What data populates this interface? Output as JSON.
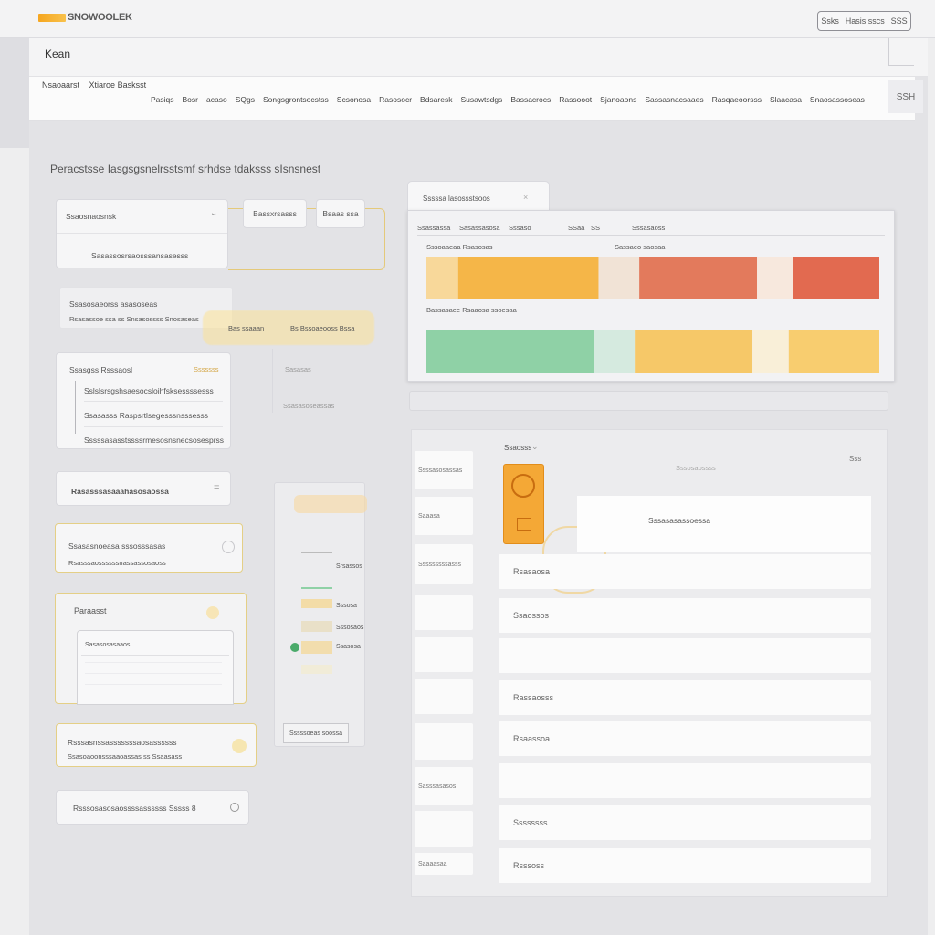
{
  "topbar": {
    "logo_text": "SNOWOOLEK",
    "button_left": "Ssks",
    "button_mid": "Hasis sscs",
    "button_right": "SSS"
  },
  "header": {
    "title": "Kean"
  },
  "breadcrumb": {
    "item1": "Nsaoaarst",
    "item2": "Xtiaroe Basksst"
  },
  "nav_tabs": [
    "Pasiqs",
    "Bosr",
    "acaso",
    "SQgs",
    "Songsgrontsocstss",
    "Scsonosa",
    "Rasosocr",
    "Bdsaresk",
    "Susawtsdgs",
    "Bassacrocs",
    "Rassooot",
    "Sjanoaons",
    "Sassasnacsaaes",
    "Rasqaeoorsss",
    "Slaacasa",
    "Snaosassoseas"
  ],
  "nav_icon": "SSH",
  "canvas": {
    "description": "Peracstsse Iasgsgsnelrsstsmf srhdse tdaksss sIsnsnest"
  },
  "left": {
    "card1_title": "Ssaosnaosnsk",
    "card1_sub": "Sasassosrsaosssansasesss",
    "pill1": "Bassxrsasss",
    "pill2": "Bsaas ssa",
    "card2_title": "Ssasosaeorss asasoseas",
    "card2_sub": "Rsasassoe ssa ss Snsasossss Snosaseas",
    "hint1": "Bas ssaaan",
    "hint2": "Bs Bssoaeooss Bssa",
    "list_title": "Ssasgss Rsssaosl",
    "list_badge": "Sssssss",
    "list_items": [
      "Sslslsrsgshsaesocsloihfsksessssesss",
      "Ssasasss Raspsrtlsegesssnsssesss",
      "Sssssasasstssssrmesosnsnecsosesprss"
    ],
    "float1": "Sasasas",
    "float2": "Ssasasoseassas",
    "card3_label": "Rasasssasaaahasosaossa",
    "card4_title": "Ssasasnoeasa sssosssasas",
    "card4_sub": "Rsasssaossssssnassassosaoss",
    "card5_title": "Paraasst",
    "card5_header": "Sasasosasaaos",
    "card6_title": "Rsssasnssasssssssaosassssss",
    "card6_sub": "Ssasoaoonsssaaoassas ss Ssaasass",
    "card7_label": "Rsssosasosaossssassssss Sssss 8"
  },
  "middle_list": {
    "items": [
      "Srsassos",
      "Sssosa",
      "Sssosaos",
      "Ssasosa"
    ],
    "footer": "Sssssoeas soossa"
  },
  "chart_panel": {
    "tab_label": "Sssssa lasossstsoos",
    "filters": [
      "Ssassassa",
      "Sasassasosa",
      "Sssaso",
      "SSaa",
      "SS",
      "Sssasaoss"
    ],
    "row1_label": "Sssoaaeaa Rsasosas",
    "row1_right": "Sassaeo saosaa",
    "row2_label": "Bassasaee Rsaaosa ssoesaa"
  },
  "chart_data": {
    "type": "bar",
    "stacked": true,
    "orientation": "horizontal",
    "categories": [
      "Sssoaaeaa Rsasosas",
      "Bassasaee Rsaaosa ssoesaa"
    ],
    "series": [
      {
        "values": [
          0.07,
          0.0
        ]
      },
      {
        "values": [
          0.31,
          0.37
        ]
      },
      {
        "values": [
          0.09,
          0.09
        ]
      },
      {
        "values": [
          0.26,
          0.26
        ]
      },
      {
        "values": [
          0.08,
          0.08
        ]
      },
      {
        "values": [
          0.19,
          0.2
        ]
      }
    ],
    "colors": [
      "#f8d89a",
      "#f5b648",
      "#f1e3d6",
      "#e37a5c",
      "#f7e8dd",
      "#e26a50",
      "#8fd1a6",
      "#d5eadf",
      "#f6c868",
      "#f9efd8",
      "#f8cd6f"
    ]
  },
  "right_panel": {
    "title": "Ssaosss",
    "icon_label": "Sss",
    "search_placeholder": "Sssosaossss",
    "card_label": "Sssasasassoessa",
    "rows": [
      "Rsasaosa",
      "Ssaossos",
      "",
      "Rassaosss",
      "Rsaassoa",
      "",
      "Ssssssss",
      "Rsssoss"
    ],
    "mini_rows": [
      "Ssssasosassas",
      "Saaasa",
      "Sssssssssasss",
      "",
      "",
      "",
      "",
      "Sasssasasos",
      "",
      "Saaaasaa"
    ]
  }
}
